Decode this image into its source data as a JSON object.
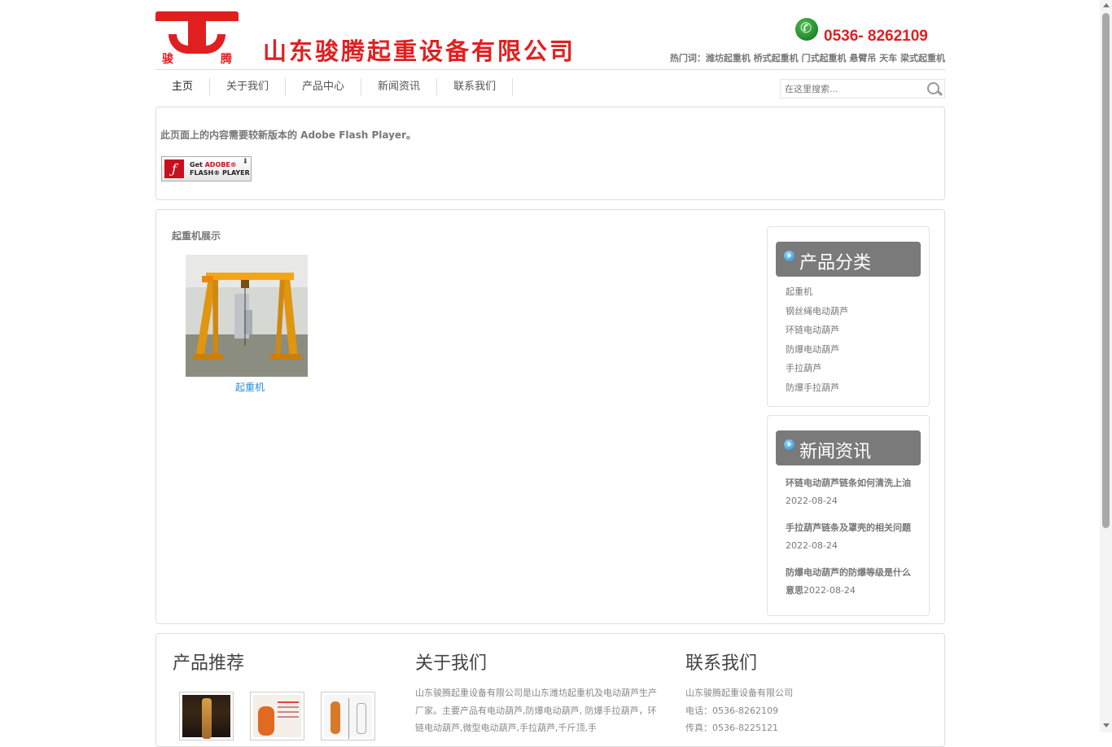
{
  "header": {
    "logo_chars": [
      "骏",
      "腾"
    ],
    "company_name": "山东骏腾起重设备有限公司",
    "phone": "0536- 8262109",
    "hot_words": "热门词：潍坊起重机 桥式起重机 门式起重机 悬臂吊 天车 梁式起重机"
  },
  "nav": {
    "items": [
      "主页",
      "关于我们",
      "产品中心",
      "新闻资讯",
      "联系我们"
    ],
    "search_placeholder": "在这里搜索..."
  },
  "flash": {
    "message": "此页面上的内容需要较新版本的 Adobe Flash Player。",
    "button_line1_prefix": "Get ",
    "button_line1_brand": "ADOBE®",
    "button_line2": "FLASH® PLAYER"
  },
  "main": {
    "section_title": "起重机展示",
    "product": {
      "caption": "起重机"
    }
  },
  "sidebar": {
    "categories_title": "产品分类",
    "categories": [
      "起重机",
      "钢丝绳电动葫芦",
      "环链电动葫芦",
      "防爆电动葫芦",
      "手拉葫芦",
      "防爆手拉葫芦"
    ],
    "news_title": "新闻资讯",
    "news": [
      {
        "title": "环链电动葫芦链条如何清洗上油",
        "date": "2022-08-24"
      },
      {
        "title": "手拉葫芦链条及罩壳的相关问题",
        "date": "2022-08-24"
      },
      {
        "title": "防爆电动葫芦的防爆等级是什么意思",
        "date": "2022-08-24"
      }
    ]
  },
  "bottom": {
    "products_title": "产品推荐",
    "about_title": "关于我们",
    "about_text": "山东骏腾起重设备有限公司是山东潍坊起重机及电动葫芦生产厂家。主要产品有电动葫芦,防爆电动葫芦, 防爆手拉葫芦，环链电动葫芦,微型电动葫芦,手拉葫芦,千斤顶,手",
    "contact_title": "联系我们",
    "contact_company": "山东骏腾起重设备有限公司",
    "contact_phone": "电话：0536-8262109",
    "contact_fax": "传真：0536-8225121"
  },
  "colors": {
    "brand_red": "#e02020",
    "side_header": "#7a7a7a",
    "link_blue": "#1f8fd8"
  }
}
